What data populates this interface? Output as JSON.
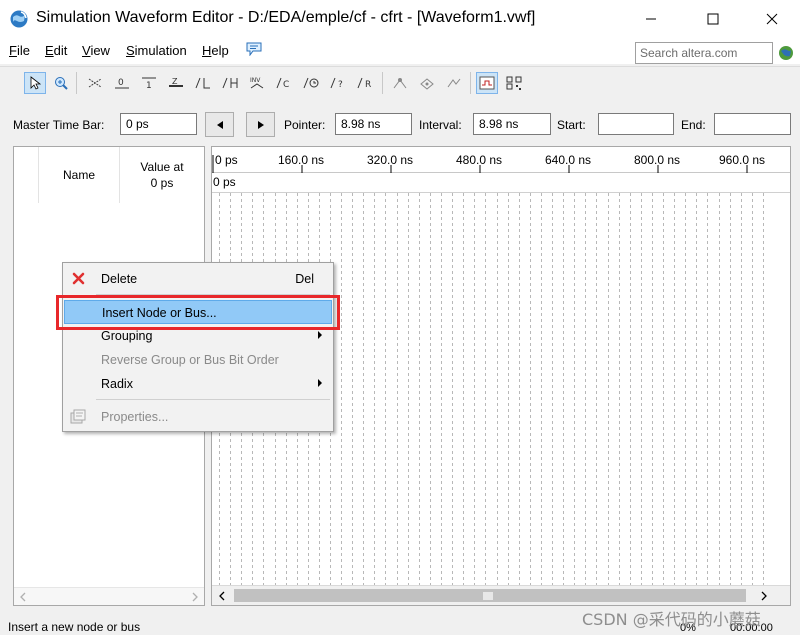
{
  "window": {
    "title": "Simulation Waveform Editor - D:/EDA/emple/cf - cfrt - [Waveform1.vwf]"
  },
  "menu": [
    {
      "label": "File",
      "u": "F",
      "rest": "ile"
    },
    {
      "label": "Edit",
      "u": "E",
      "rest": "dit"
    },
    {
      "label": "View",
      "u": "V",
      "rest": "iew"
    },
    {
      "label": "Simulation",
      "u": "S",
      "rest": "imulation"
    },
    {
      "label": "Help",
      "u": "H",
      "rest": "elp"
    }
  ],
  "search": {
    "placeholder": "Search altera.com"
  },
  "timebar": {
    "master_label": "Master Time Bar:",
    "master_value": "0 ps",
    "pointer_label": "Pointer:",
    "pointer_value": "8.98 ns",
    "interval_label": "Interval:",
    "interval_value": "8.98 ns",
    "start_label": "Start:",
    "start_value": "",
    "end_label": "End:",
    "end_value": ""
  },
  "node_list": {
    "name_header": "Name",
    "value_header_line1": "Value at",
    "value_header_line2": "0 ps"
  },
  "ruler": {
    "ticks": [
      "0 ps",
      "160.0 ns",
      "320.0 ns",
      "480.0 ns",
      "640.0 ns",
      "800.0 ns",
      "960.0 ns"
    ],
    "cursor_label": "0 ps"
  },
  "context_menu": {
    "items": [
      {
        "label": "Delete",
        "shortcut": "Del"
      },
      {
        "label": "Insert Node or Bus..."
      },
      {
        "label": "Grouping"
      },
      {
        "label": "Reverse Group or Bus Bit Order"
      },
      {
        "label": "Radix"
      },
      {
        "label": "Properties..."
      }
    ]
  },
  "status": {
    "message": "Insert a new node or bus",
    "progress": "0%",
    "time": "00:00:00"
  },
  "watermark": "CSDN @采代码的小蘑菇",
  "colors": {
    "highlight": "#91c9f7",
    "annotation_box": "#e8272a",
    "delete_icon": "#e03030"
  }
}
